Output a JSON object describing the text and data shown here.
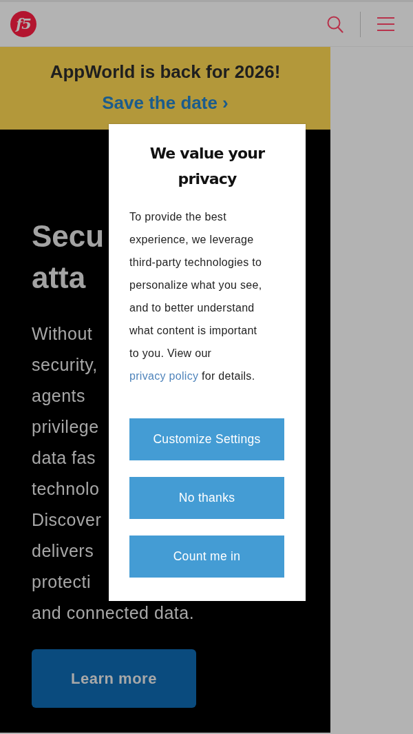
{
  "header": {
    "logo_text": "f5"
  },
  "banner": {
    "text": "AppWorld is back for 2026!",
    "link": "Save the date ›"
  },
  "hero": {
    "heading_lines": [
      "Secu",
      "atta"
    ],
    "body_lines": [
      "Without",
      "security,",
      "agents",
      "privilege",
      "data fas",
      "technolo",
      "Discover",
      "delivers",
      "protecti",
      "and connected data."
    ],
    "button": "Learn more"
  },
  "cookie_dialog": {
    "title": "We value your privacy",
    "body": "To provide the best experience, we leverage third-party technologies to personalize what you see, and to better understand what content is important to you. View our",
    "link": "privacy policy",
    "body_end": "for details.",
    "buttons": [
      "Customize Settings",
      "No thanks",
      "Count me in"
    ]
  }
}
